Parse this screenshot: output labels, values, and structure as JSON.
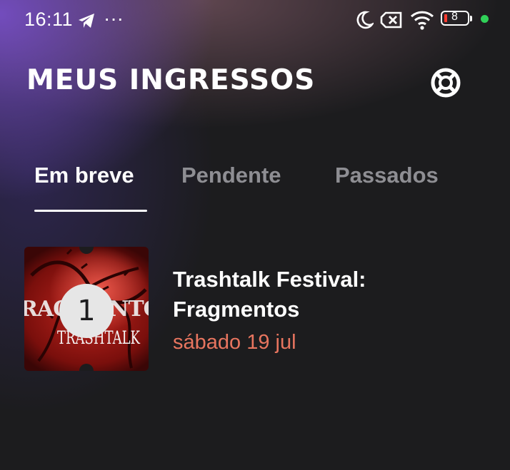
{
  "status_bar": {
    "time": "16:11",
    "icons": [
      "telegram-icon",
      "more-dots-icon",
      "moon-icon",
      "sim-off-icon",
      "wifi-icon",
      "battery-icon",
      "online-dot-icon"
    ],
    "battery_level": "8",
    "dots": "···"
  },
  "header": {
    "title": "MEUS INGRESSOS",
    "help_icon": "lifebuoy-icon"
  },
  "tabs": [
    {
      "label": "Em breve",
      "active": true
    },
    {
      "label": "Pendente",
      "active": false
    },
    {
      "label": "Passados",
      "active": false
    }
  ],
  "tickets": [
    {
      "count": "1",
      "title": "Trashtalk Festival: Fragmentos",
      "date": "sábado 19 jul",
      "art_text": "RAGMENTO",
      "art_logo": "TRASHTALK"
    }
  ],
  "colors": {
    "background": "#1c1c1e",
    "accent_date": "#e8755f",
    "tab_inactive": "#8e8e93",
    "online_dot": "#30d158"
  }
}
